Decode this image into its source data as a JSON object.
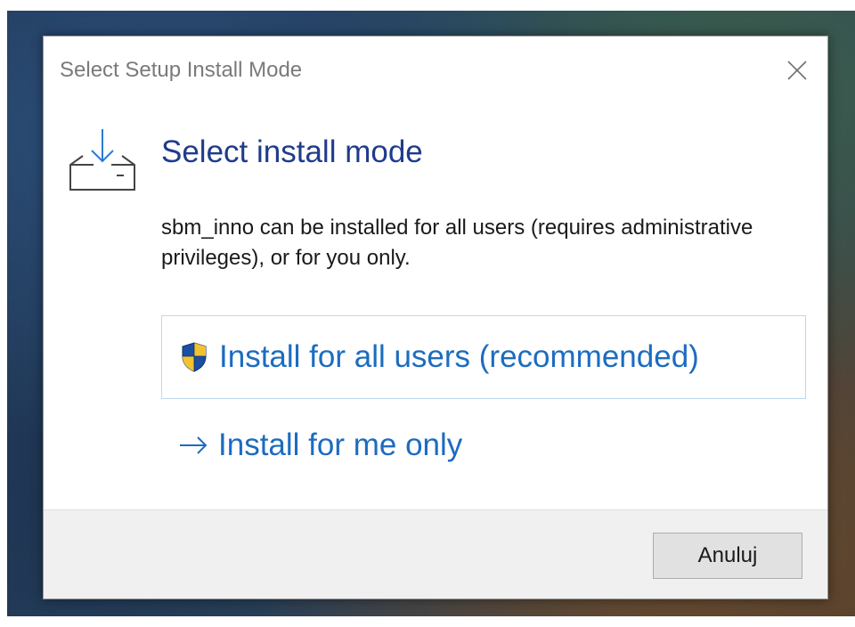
{
  "window": {
    "title": "Select Setup Install Mode",
    "close_icon": "close-icon"
  },
  "content": {
    "header_icon": "download-tray-icon",
    "instruction": "Select install mode",
    "description": "sbm_inno can be installed for all users (requires administrative privileges), or for you only."
  },
  "options": {
    "all_users": {
      "icon": "uac-shield-icon",
      "label": "Install for all users (recommended)",
      "selected": true
    },
    "me_only": {
      "icon": "arrow-right-icon",
      "label": "Install for me only",
      "selected": false
    }
  },
  "footer": {
    "cancel_label": "Anuluj"
  },
  "colors": {
    "instruction": "#1f3b8c",
    "link": "#1c6cc0",
    "footer_bg": "#f0f0f0"
  }
}
